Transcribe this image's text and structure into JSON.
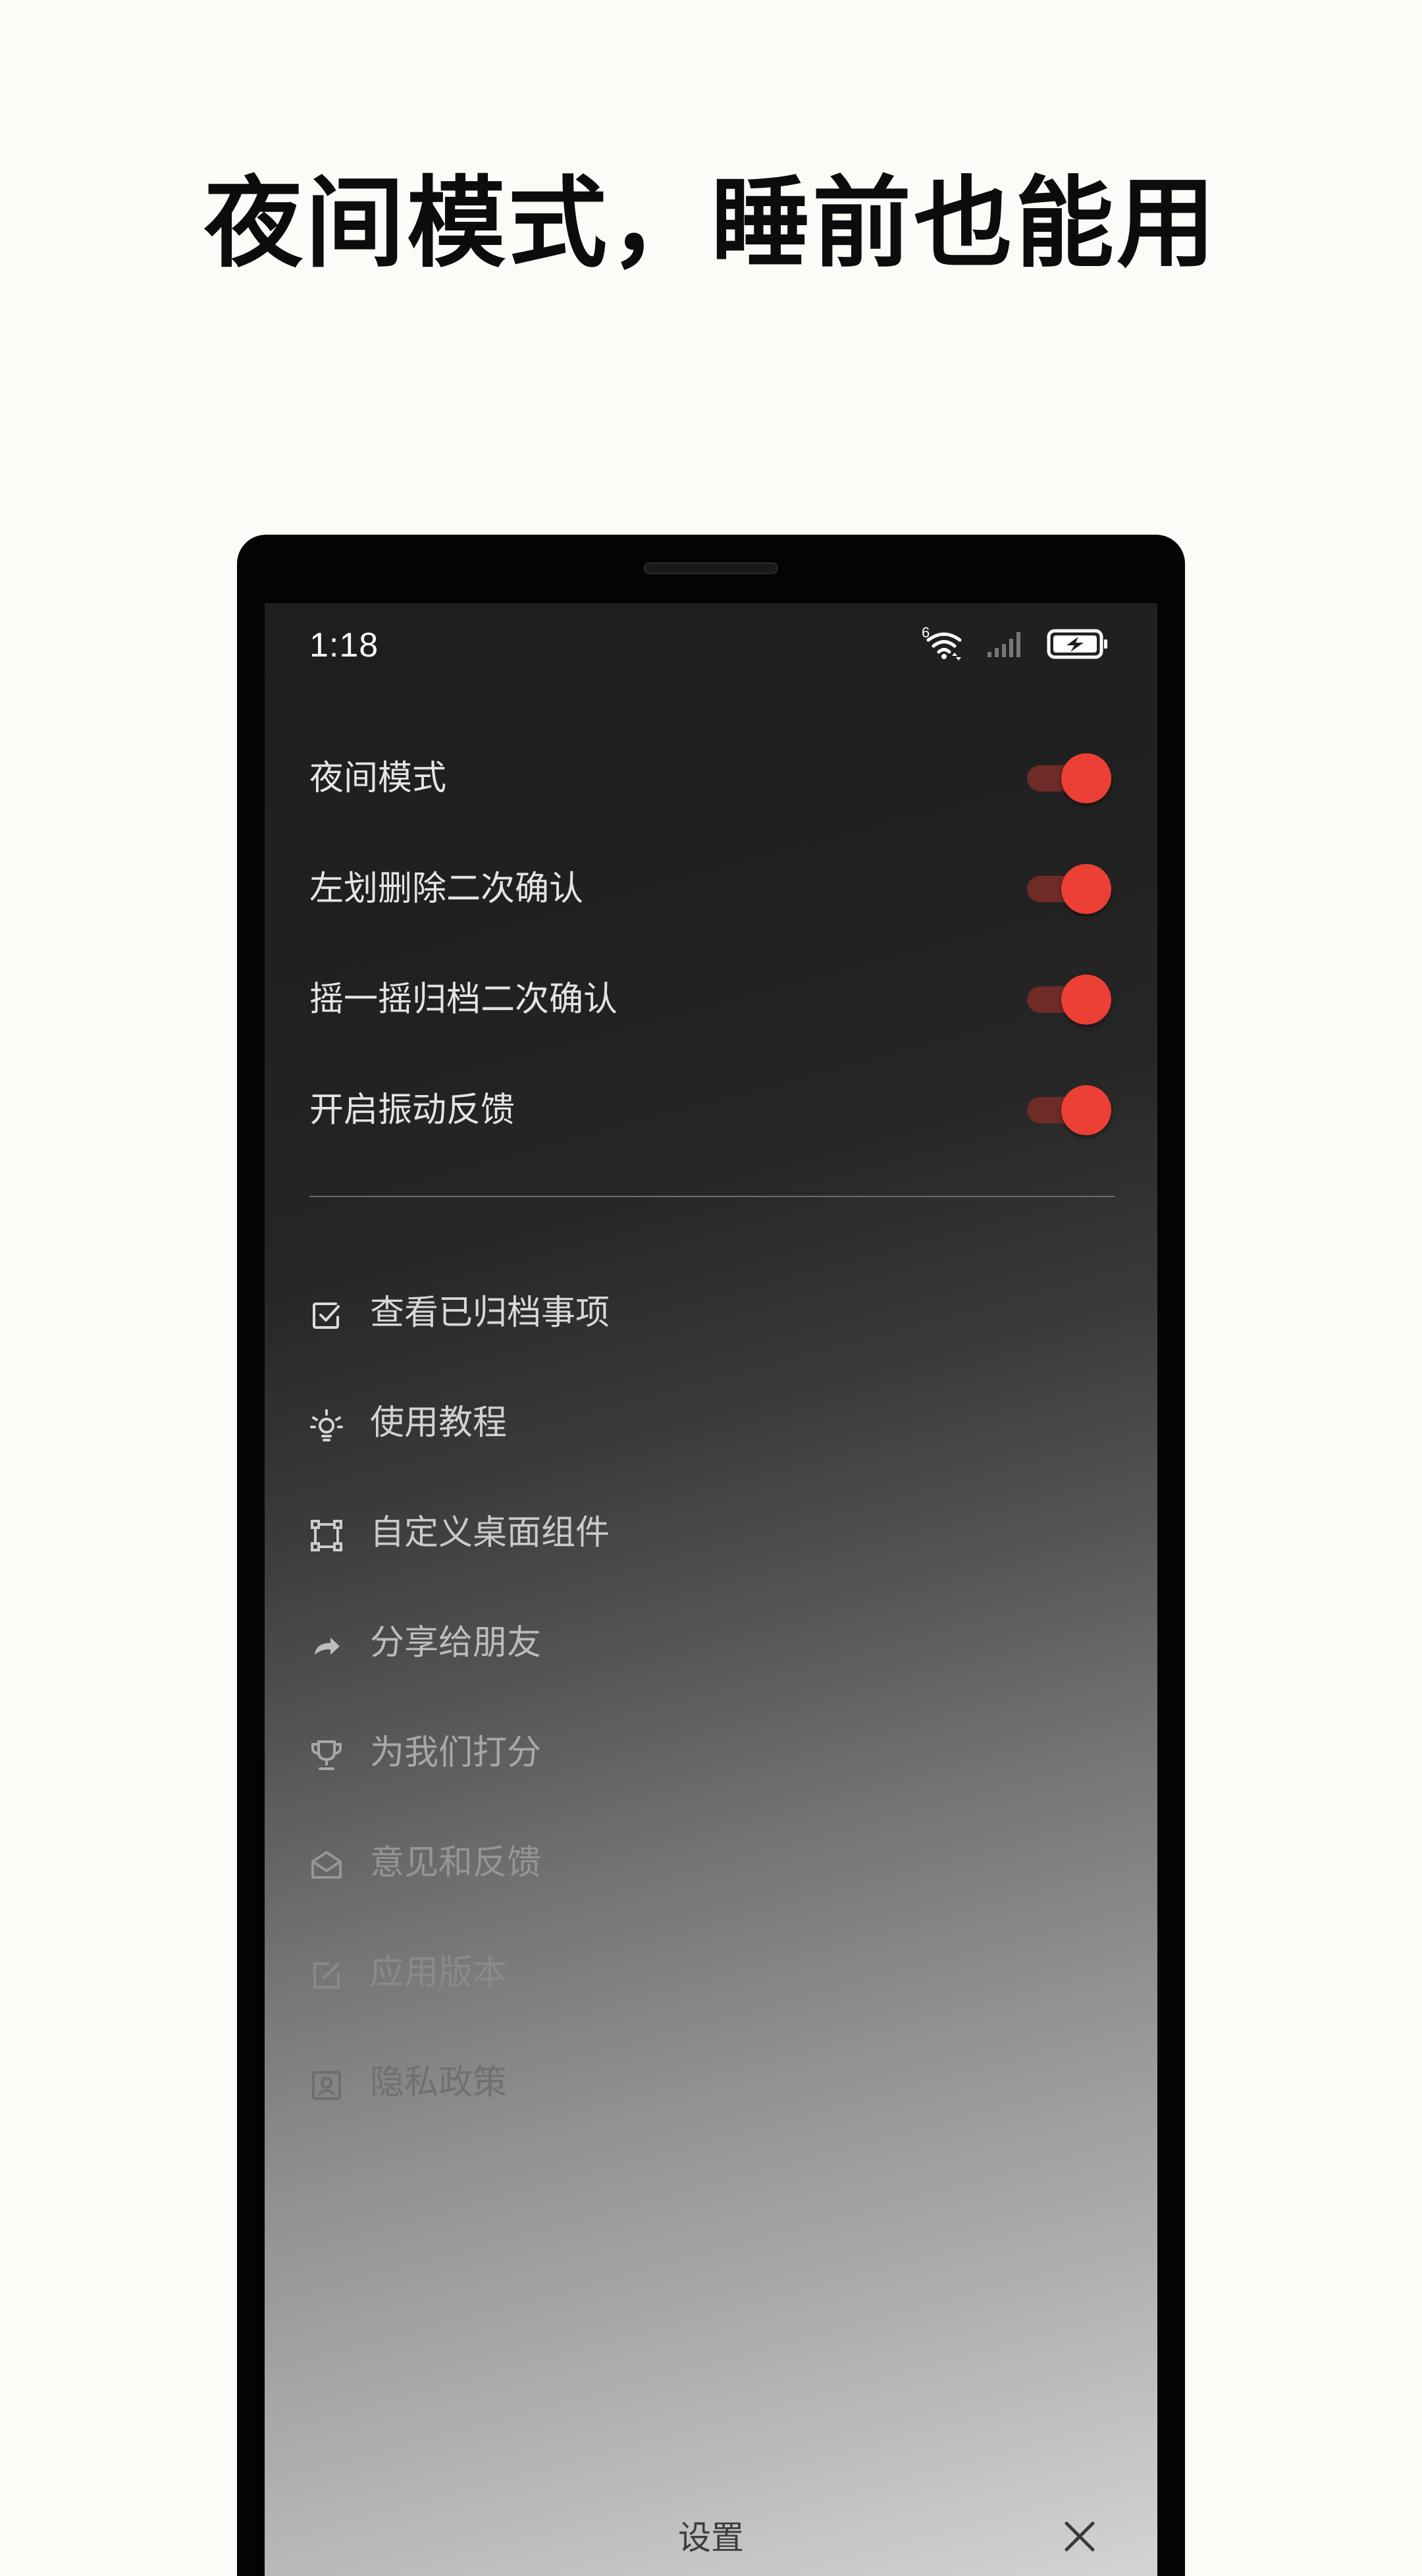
{
  "headline": "夜间模式，睡前也能用",
  "status_bar": {
    "time": "1:18",
    "wifi_badge": "6",
    "icons": [
      "wifi-icon",
      "signal-icon",
      "battery-charging-icon"
    ]
  },
  "toggles": [
    {
      "label": "夜间模式",
      "on": true
    },
    {
      "label": "左划删除二次确认",
      "on": true
    },
    {
      "label": "摇一摇归档二次确认",
      "on": true
    },
    {
      "label": "开启振动反馈",
      "on": true
    }
  ],
  "menu": [
    {
      "label": "查看已归档事项",
      "icon": "checkbox-icon"
    },
    {
      "label": "使用教程",
      "icon": "lightbulb-icon"
    },
    {
      "label": "自定义桌面组件",
      "icon": "widget-frame-icon"
    },
    {
      "label": "分享给朋友",
      "icon": "share-arrow-icon"
    },
    {
      "label": "为我们打分",
      "icon": "trophy-icon"
    },
    {
      "label": "意见和反馈",
      "icon": "mail-open-icon"
    },
    {
      "label": "应用版本",
      "icon": "edit-icon"
    },
    {
      "label": "隐私政策",
      "icon": "contact-card-icon"
    }
  ],
  "bottom_bar": {
    "title": "设置",
    "close_icon": "close-icon"
  },
  "colors": {
    "page_background": "#fdfbf8",
    "accent": "#ec3f35",
    "switch_track": "#6e2b28",
    "screen_top": "#1e1e1e",
    "screen_bottom": "#d4d4d4"
  }
}
